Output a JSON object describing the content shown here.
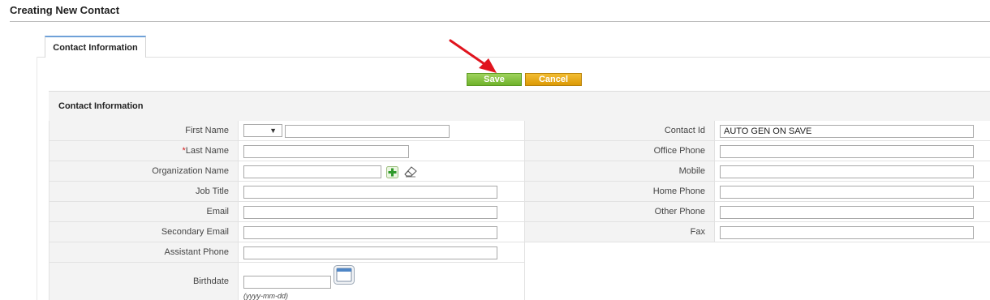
{
  "page_title": "Creating New Contact",
  "tab_label": "Contact Information",
  "buttons": {
    "save": "Save",
    "cancel": "Cancel"
  },
  "section_title": "Contact Information",
  "left_fields": {
    "first_name": "First Name",
    "last_name_req": "*",
    "last_name": "Last Name",
    "organization_name": "Organization Name",
    "job_title": "Job Title",
    "email": "Email",
    "secondary_email": "Secondary Email",
    "assistant_phone": "Assistant Phone",
    "birthdate": "Birthdate",
    "birthdate_hint": "(yyyy-mm-dd)"
  },
  "right_fields": {
    "contact_id": "Contact Id",
    "contact_id_value": "AUTO GEN ON SAVE",
    "office_phone": "Office Phone",
    "mobile": "Mobile",
    "home_phone": "Home Phone",
    "other_phone": "Other Phone",
    "fax": "Fax"
  },
  "salutation_glyph": "▼",
  "icons": {
    "add": "plus-icon",
    "clear": "eraser-icon",
    "calendar": "calendar-icon",
    "annotation": "red-arrow"
  },
  "colors": {
    "save": "#7cbf35",
    "cancel": "#e7a61a",
    "tab_accent": "#6fa1d8",
    "required": "#d21f1f",
    "arrow": "#e0141e"
  }
}
